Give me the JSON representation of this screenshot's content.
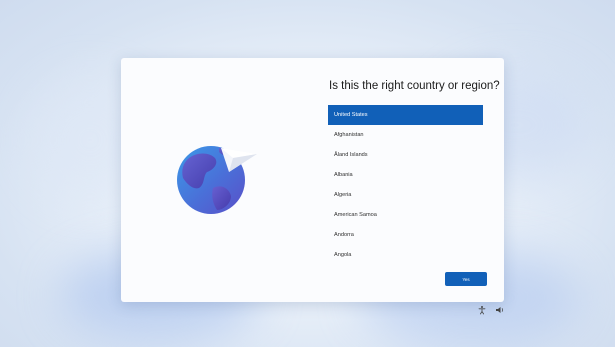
{
  "setup": {
    "question": "Is this the right country or region?",
    "countries": [
      "United States",
      "Afghanistan",
      "Åland Islands",
      "Albania",
      "Algeria",
      "American Samoa",
      "Andorra",
      "Angola"
    ],
    "selected_country": "United States",
    "confirm_label": "Yes"
  },
  "illustration": {
    "icon": "globe-icon",
    "overlay_icon": "paper-plane-icon"
  },
  "tray": {
    "icons": [
      "accessibility-icon",
      "speaker-icon"
    ]
  },
  "colors": {
    "accent": "#1160b8",
    "card_background": "#fbfcfe",
    "globe": "#4a78d8"
  }
}
